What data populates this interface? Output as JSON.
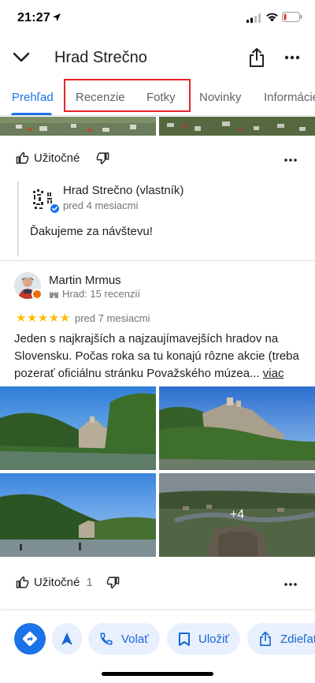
{
  "status_bar": {
    "time": "21:27",
    "icons": [
      "location-arrow-icon",
      "signal-icon",
      "wifi-icon",
      "battery-low-icon"
    ]
  },
  "header": {
    "title": "Hrad Strečno",
    "back_icon": "chevron-down-icon",
    "share_icon": "share-icon",
    "more_icon": "more-horizontal-icon"
  },
  "tabs": [
    {
      "label": "Prehľad",
      "active": true
    },
    {
      "label": "Recenzie",
      "active": false
    },
    {
      "label": "Fotky",
      "active": false
    },
    {
      "label": "Novinky",
      "active": false
    },
    {
      "label": "Informácie",
      "active": false
    }
  ],
  "review_1": {
    "helpful_label": "Užitočné",
    "owner_reply": {
      "name": "Hrad Strečno (vlastník)",
      "date": "pred 4 mesiacmi",
      "text": "Ďakujeme za návštevu!"
    }
  },
  "review_2": {
    "reviewer_name": "Martin Mrmus",
    "reviewer_meta": "Hrad: 15 recenzií",
    "rating": "★★★★★",
    "rating_value": 5,
    "date": "pred 7 mesiacmi",
    "text": "Jeden s najkrajších a najzaujímavejších hradov na Slovensku. Počas roka sa tu konajú rôzne akcie (treba pozerať oficiálnu stránku Považského múzea...",
    "more_label": "viac",
    "extra_photos": "+4",
    "helpful_label": "Užitočné",
    "helpful_count": "1"
  },
  "bottom_bar": {
    "call_label": "Volať",
    "save_label": "Uložiť",
    "share_label": "Zdieľať"
  },
  "colors": {
    "accent": "#1a73e8",
    "star": "#fbbc04",
    "highlight_box": "#e8232a",
    "pill_bg": "#e8f0fe"
  }
}
